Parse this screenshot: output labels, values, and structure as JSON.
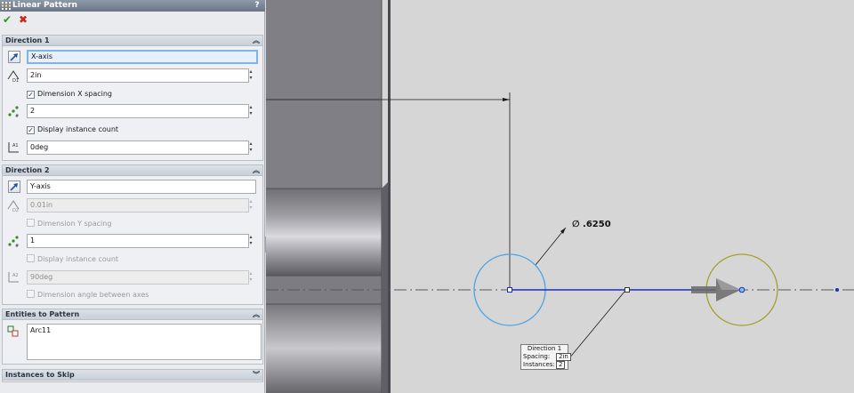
{
  "panel": {
    "title": "Linear Pattern",
    "help": "?",
    "ok_icon": "✔",
    "cancel_icon": "✖",
    "direction1": {
      "header": "Direction 1",
      "direction_ref": "X-axis",
      "spacing": "2in",
      "dimension_spacing_label": "Dimension X spacing",
      "dimension_spacing_checked": true,
      "instances": "2",
      "display_count_label": "Display instance count",
      "display_count_checked": true,
      "angle": "0deg"
    },
    "direction2": {
      "header": "Direction 2",
      "direction_ref": "Y-axis",
      "spacing": "0.01in",
      "dimension_spacing_label": "Dimension Y spacing",
      "dimension_spacing_checked": false,
      "instances": "1",
      "display_count_label": "Display instance count",
      "display_count_checked": false,
      "angle": "90deg",
      "dimension_angle_label": "Dimension angle between axes",
      "dimension_angle_checked": false
    },
    "entities": {
      "header": "Entities to Pattern",
      "items": [
        "Arc11"
      ]
    },
    "skip": {
      "header": "Instances to Skip"
    }
  },
  "viewport": {
    "diameter_label": "∅ .6250",
    "callout": {
      "title": "Direction 1",
      "spacing_label": "Spacing:",
      "spacing_value": "2in",
      "instances_label": "Instances:",
      "instances_value": "2"
    }
  },
  "colors": {
    "selected_arc": "#4aa3e8",
    "preview_arc": "#a3a02a",
    "pattern_line": "#1f2bbd",
    "centerline": "#5a5a5a"
  }
}
